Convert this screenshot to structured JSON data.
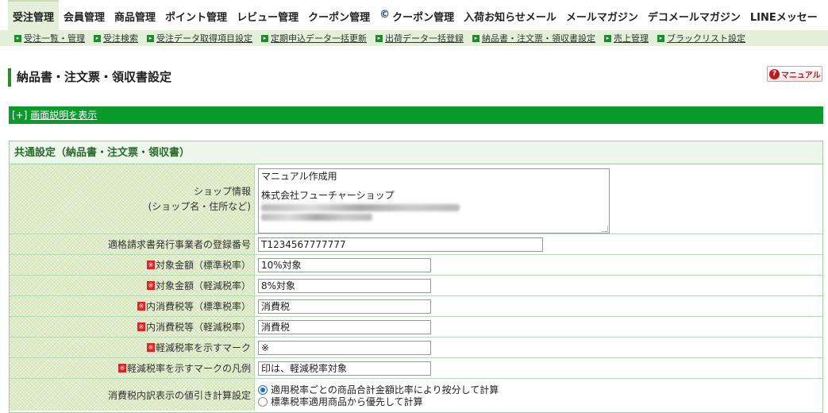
{
  "topnav": {
    "tabs": [
      {
        "label": "受注管理",
        "active": true
      },
      {
        "label": "会員管理"
      },
      {
        "label": "商品管理"
      },
      {
        "label": "ポイント管理"
      },
      {
        "label": "レビュー管理"
      },
      {
        "label": "クーポン管理"
      },
      {
        "label": "クーポン管理",
        "icon": "c-coupon-icon"
      },
      {
        "label": "入荷お知らせメール"
      },
      {
        "label": "メールマガジン"
      },
      {
        "label": "デコメールマガジン"
      },
      {
        "label": "LINEメッセー"
      }
    ]
  },
  "subnav": {
    "items": [
      "受注一覧・管理",
      "受注検索",
      "受注データ取得項目設定",
      "定期申込データ一括更新",
      "出荷データ一括登録",
      "納品書・注文票・領収書設定",
      "売上管理",
      "ブラックリスト設定"
    ]
  },
  "page": {
    "title": "納品書・注文票・領収書設定",
    "manual_label": "マニュアル",
    "help_toggle_prefix": "[+]",
    "help_toggle_label": "画面説明を表示"
  },
  "settings": {
    "section_title": "共通設定（納品書・注文票・領収書）",
    "shop_info": {
      "label_line1": "ショップ情報",
      "label_line2": "(ショップ名・住所など)",
      "value_line1": "マニュアル作成用",
      "value_line3": "株式会社フューチャーショップ"
    },
    "registration_number": {
      "label": "適格請求書発行事業者の登録番号",
      "value": "T1234567777777"
    },
    "target_standard": {
      "label": "対象金額（標準税率）",
      "value": "10%対象"
    },
    "target_reduced": {
      "label": "対象金額（軽減税率）",
      "value": "8%対象"
    },
    "tax_standard": {
      "label": "内消費税等（標準税率）",
      "value": "消費税"
    },
    "tax_reduced": {
      "label": "内消費税等（軽減税率）",
      "value": "消費税"
    },
    "reduced_mark": {
      "label": "軽減税率を示すマーク",
      "value": "※"
    },
    "reduced_mark_legend": {
      "label": "軽減税率を示すマークの凡例",
      "value": "印は、軽減税率対象"
    },
    "discount_calc": {
      "label": "消費税内訳表示の値引き計算設定",
      "option1": "適用税率ごとの商品合計金額比率により按分して計算",
      "option2": "標準税率適用商品から優先して計算",
      "selected": 1
    },
    "required_mark": "※"
  },
  "colors": {
    "accent_green": "#0a9a2c",
    "required_red": "#e22222"
  }
}
